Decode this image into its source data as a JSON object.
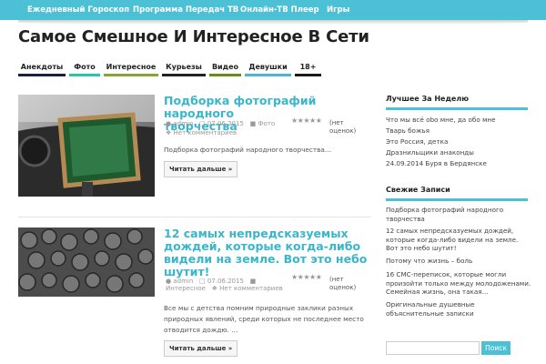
{
  "topnav": {
    "items": [
      "Ежедневный Гороскоп",
      "Программа Передач ТВ",
      "Онлайн-ТВ Плеер",
      "Игры"
    ]
  },
  "site": {
    "title": "Самое Смешное И Интересное В Сети"
  },
  "categories": [
    {
      "label": "Анекдоты",
      "color": "#1b1e3f"
    },
    {
      "label": "Фото",
      "color": "#23c8a8"
    },
    {
      "label": "Интересное",
      "color": "#86a43a"
    },
    {
      "label": "Курьезы",
      "color": "#222222"
    },
    {
      "label": "Видео",
      "color": "#6a8a1a"
    },
    {
      "label": "Девушки",
      "color": "#4ab6d8"
    },
    {
      "label": "18+",
      "color": "#1a1a1a"
    }
  ],
  "posts": [
    {
      "title_lines": [
        "Подборка фотографий народного",
        "творчества"
      ],
      "author": "admin",
      "date": "07.06.2015",
      "category": "Фото",
      "comments": "Нет комментариев",
      "rating_lines": [
        "(нет",
        "оценок)"
      ],
      "excerpt_lines": [
        "Подборка фотографий народного творчества…"
      ],
      "more": "Читать дальше »"
    },
    {
      "title_lines": [
        "12 самых непредсказуемых",
        "дождей, которые когда-либо",
        "видели на земле. Вот это небо",
        "шутит!"
      ],
      "author": "admin",
      "date": "07.06.2015",
      "category": "Интересное",
      "comments": "Нет комментариев",
      "rating_lines": [
        "(нет",
        "оценок)"
      ],
      "excerpt_lines": [
        "Все мы с детства помним природные заклики разных",
        "природных явлений, среди которых не последнее место",
        "отводится дождю. …"
      ],
      "more": "Читать дальше »"
    }
  ],
  "sidebar": {
    "best_week": {
      "title": "Лучшее За Неделю",
      "items": [
        "Что мы всё оbо мне, да обо мне",
        "Тварь божья",
        "Это Россия, детка",
        "Дразнильщики анаконды",
        "24.09.2014 Буря в Бердянске"
      ]
    },
    "recent": {
      "title": "Свежие Записи",
      "items": [
        [
          "Подборка фотографий народного",
          "творчества"
        ],
        [
          "12 самых непредсказуемых дождей,",
          "которые когда-либо видели на земле.",
          "Вот это небо шутит!"
        ],
        [
          "Потому что жизнь – боль"
        ],
        [
          "16 СМС-переписок, которые могли",
          "произойти только между молодоженами.",
          "Семейная жизнь, она такая…"
        ],
        [
          "Оригинальные душевные",
          "объяснительные записки"
        ]
      ]
    },
    "search": {
      "placeholder": "",
      "button": "Поиск"
    }
  },
  "colors": {
    "accent": "#4cc1d6",
    "title_link": "#3ab6cc"
  }
}
